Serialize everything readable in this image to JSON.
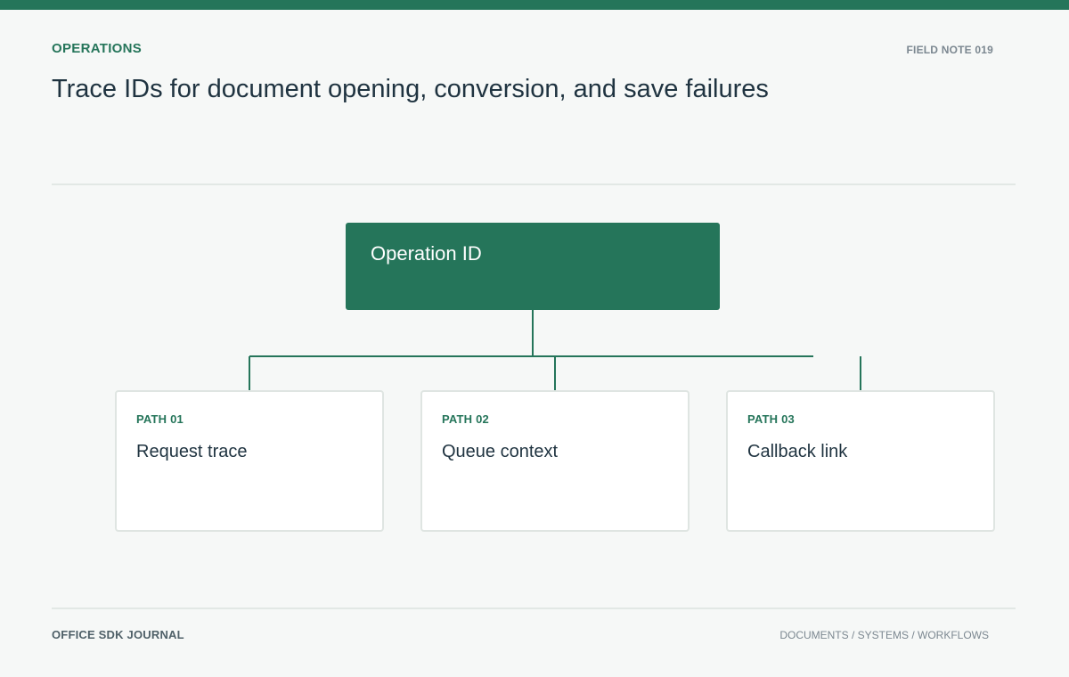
{
  "header": {
    "section_label": "OPERATIONS",
    "field_note": "FIELD NOTE 019",
    "title": "Trace IDs for document opening, conversion, and save failures"
  },
  "diagram": {
    "root": {
      "label": "Operation ID"
    },
    "paths": [
      {
        "kicker": "PATH 01",
        "title": "Request trace"
      },
      {
        "kicker": "PATH 02",
        "title": "Queue context"
      },
      {
        "kicker": "PATH 03",
        "title": "Callback link"
      }
    ]
  },
  "footer": {
    "journal": "OFFICE SDK JOURNAL",
    "categories": "DOCUMENTS / SYSTEMS / WORKFLOWS"
  },
  "colors": {
    "accent": "#25755a",
    "background": "#f6f8f7",
    "card_border": "#dfe5e2",
    "text": "#1f3340",
    "muted": "#7b8790"
  }
}
